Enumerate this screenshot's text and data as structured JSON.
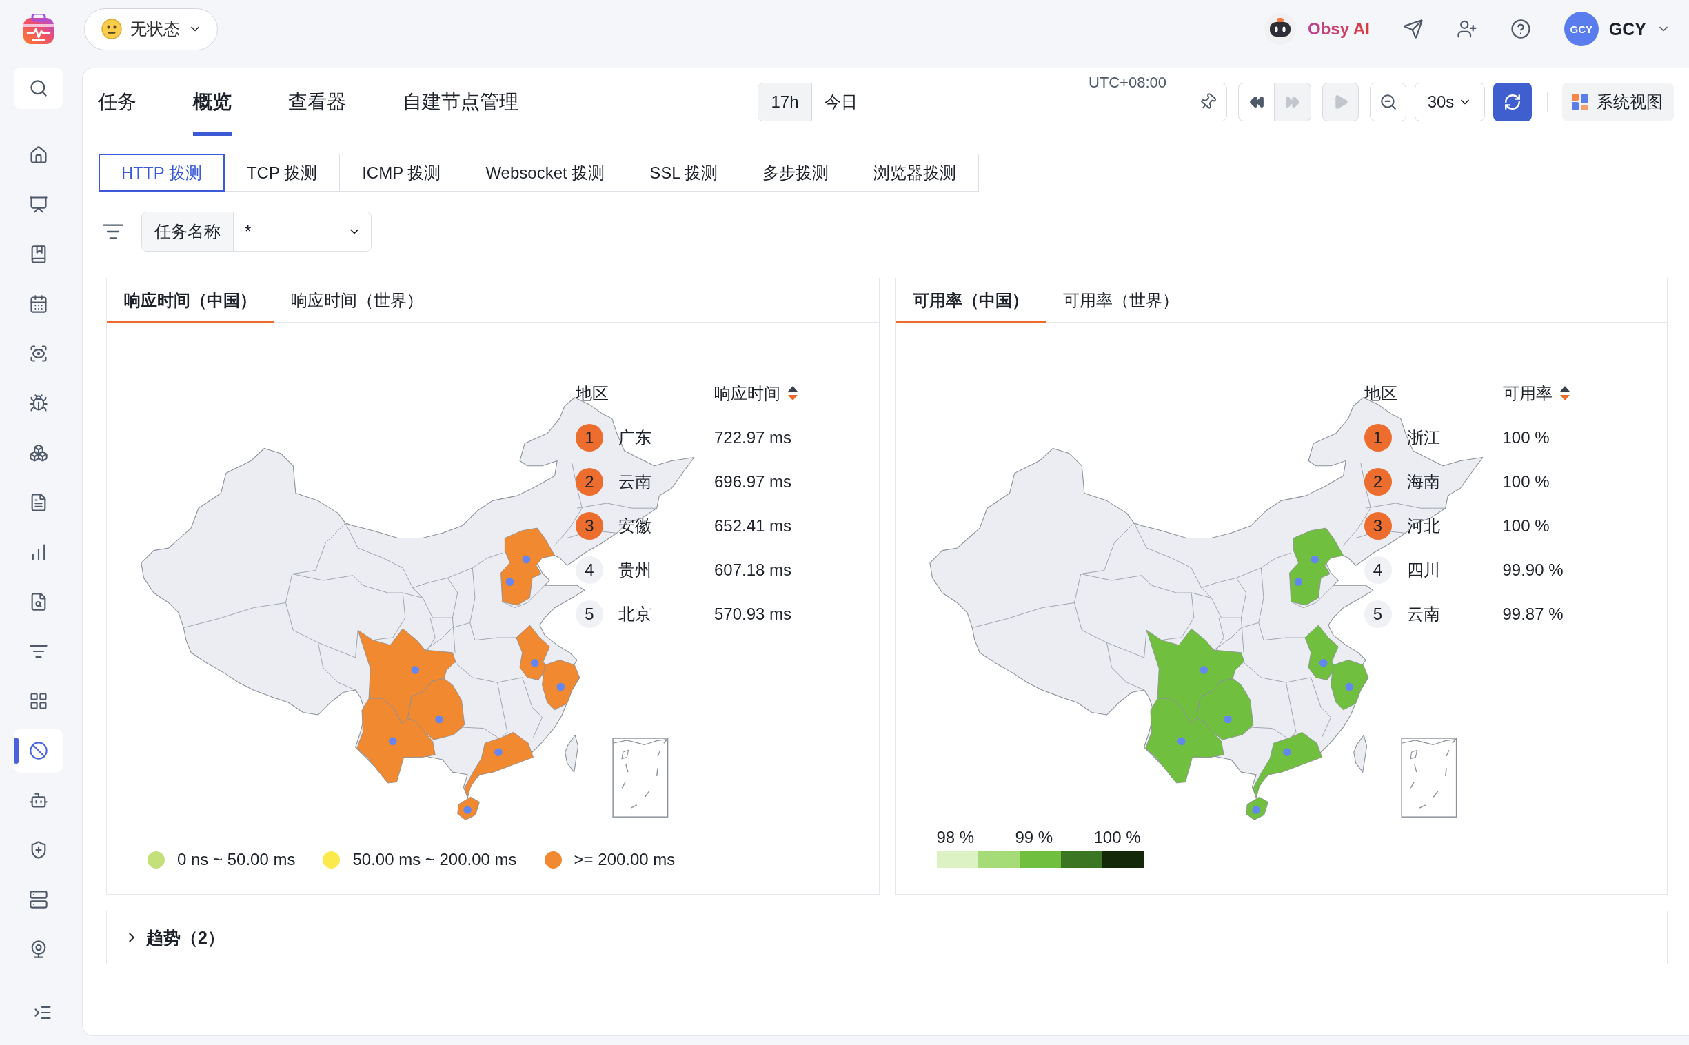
{
  "top_bar": {
    "status": "无状态",
    "assistant": "Obsy AI",
    "user": {
      "initials": "GCY",
      "name": "GCY"
    }
  },
  "sidebar": {
    "items": [
      {
        "selected": false
      },
      {
        "selected": false
      },
      {
        "selected": false
      },
      {
        "selected": false
      },
      {
        "selected": false
      },
      {
        "selected": false
      },
      {
        "selected": false
      },
      {
        "selected": false
      },
      {
        "selected": false
      },
      {
        "selected": false
      },
      {
        "selected": false
      },
      {
        "selected": false
      },
      {
        "selected": true
      },
      {
        "selected": false
      },
      {
        "selected": false
      },
      {
        "selected": false
      },
      {
        "selected": false
      }
    ]
  },
  "tabs": [
    {
      "label": "任务",
      "selected": false
    },
    {
      "label": "概览",
      "selected": true
    },
    {
      "label": "查看器",
      "selected": false
    },
    {
      "label": "自建节点管理",
      "selected": false
    }
  ],
  "time_range": {
    "duration": "17h",
    "value": "今日",
    "timezone": "UTC+08:00"
  },
  "playback": {
    "rewind": {
      "disabled": false
    },
    "fast_forward": {
      "disabled": true
    },
    "play": {
      "disabled": true
    }
  },
  "refresh_interval": "30s",
  "view_button": "系统视图",
  "probe_tabs": [
    {
      "label": "HTTP 拨测",
      "selected": true
    },
    {
      "label": "TCP 拨测",
      "selected": false
    },
    {
      "label": "ICMP 拨测",
      "selected": false
    },
    {
      "label": "Websocket 拨测",
      "selected": false
    },
    {
      "label": "SSL 拨测",
      "selected": false
    },
    {
      "label": "多步拨测",
      "selected": false
    },
    {
      "label": "浏览器拨测",
      "selected": false
    }
  ],
  "filter": {
    "label": "任务名称",
    "value": "*"
  },
  "panels": [
    {
      "tabs": [
        {
          "label": "响应时间（中国）",
          "selected": true
        },
        {
          "label": "响应时间（世界）",
          "selected": false
        }
      ],
      "ranking": {
        "columns": [
          "地区",
          "响应时间"
        ],
        "sort_descending": true,
        "rows": [
          {
            "rank": "1",
            "region": "广东",
            "value": "722.97 ms",
            "highlighted": true
          },
          {
            "rank": "2",
            "region": "云南",
            "value": "696.97 ms",
            "highlighted": true
          },
          {
            "rank": "3",
            "region": "安徽",
            "value": "652.41 ms",
            "highlighted": true
          },
          {
            "rank": "4",
            "region": "贵州",
            "value": "607.18 ms",
            "highlighted": false
          },
          {
            "rank": "5",
            "region": "北京",
            "value": "570.93 ms",
            "highlighted": false
          }
        ]
      },
      "legend": {
        "kind": "categories",
        "items": [
          {
            "label": "0 ns ~ 50.00 ms",
            "color": "#c4e07a"
          },
          {
            "label": "50.00 ms ~ 200.00 ms",
            "color": "#fce94b"
          },
          {
            "label": ">= 200.00 ms",
            "color": "#f0892f"
          }
        ]
      }
    },
    {
      "tabs": [
        {
          "label": "可用率（中国）",
          "selected": true
        },
        {
          "label": "可用率（世界）",
          "selected": false
        }
      ],
      "ranking": {
        "columns": [
          "地区",
          "可用率"
        ],
        "sort_descending": true,
        "rows": [
          {
            "rank": "1",
            "region": "浙江",
            "value": "100 %",
            "highlighted": true
          },
          {
            "rank": "2",
            "region": "海南",
            "value": "100 %",
            "highlighted": true
          },
          {
            "rank": "3",
            "region": "河北",
            "value": "100 %",
            "highlighted": true
          },
          {
            "rank": "4",
            "region": "四川",
            "value": "99.90 %",
            "highlighted": false
          },
          {
            "rank": "5",
            "region": "云南",
            "value": "99.87 %",
            "highlighted": false
          }
        ]
      },
      "legend": {
        "kind": "scale",
        "labels": [
          "98 %",
          "99 %",
          "100 %"
        ],
        "steps": [
          {
            "color": "#dcf2c4"
          },
          {
            "color": "#a6dc78"
          },
          {
            "color": "#70bf3e"
          },
          {
            "color": "#3b7622"
          },
          {
            "color": "#13290a"
          }
        ]
      }
    }
  ],
  "trend": {
    "title": "趋势（2）",
    "expanded": false
  }
}
